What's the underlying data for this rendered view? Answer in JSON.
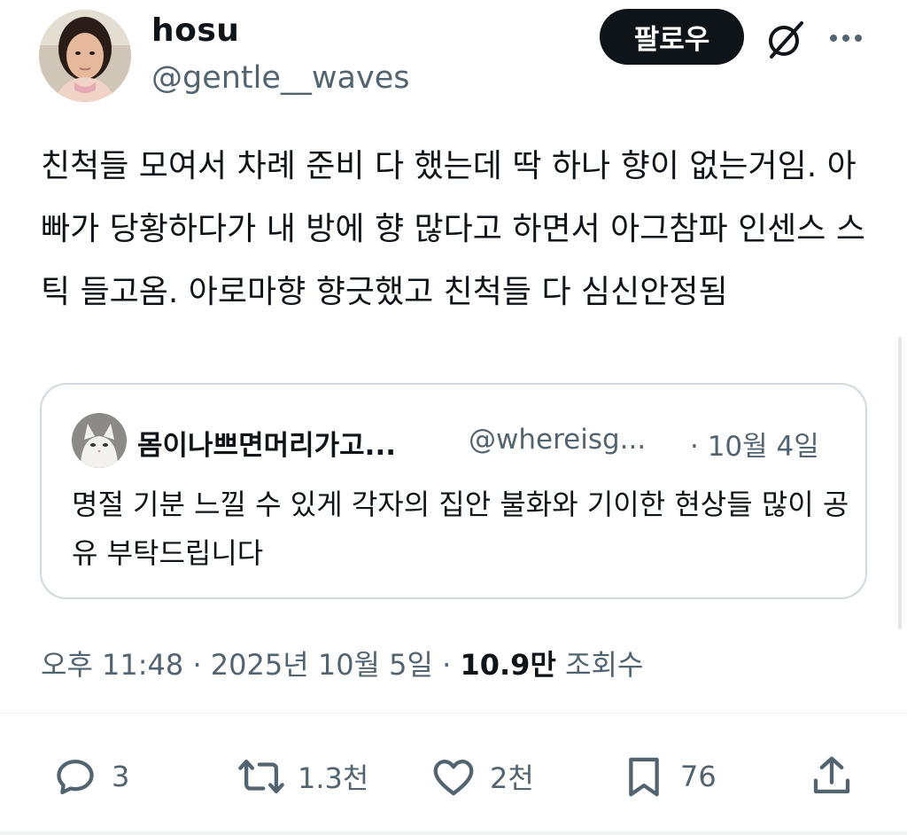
{
  "author": {
    "display_name": "hosu",
    "handle": "@gentle__waves",
    "avatar_icon": "profile-photo"
  },
  "header": {
    "follow_label": "팔로우",
    "grok_icon": "grok-icon",
    "more_icon": "more-horizontal-icon"
  },
  "tweet": {
    "text": "친척들 모여서 차례 준비 다 했는데 딱 하나 향이 없는거임. 아빠가 당황하다가 내 방에 향 많다고 하면서 아그참파 인센스 스틱 들고옴. 아로마향 향긋했고 친척들 다 심신안정됨"
  },
  "quote": {
    "display_name": "몸이나쁘면머리가고...",
    "handle": "@whereisg...",
    "date": "· 10월 4일",
    "text": "명절 기분 느낄 수 있게 각자의 집안 불화와 기이한 현상들 많이 공유 부탁드립니다",
    "avatar_icon": "cat-photo"
  },
  "meta": {
    "time": "오후 11:48 · 2025년 10월 5일 ·",
    "views_count": "10.9만",
    "views_label": "조회수"
  },
  "actions": {
    "reply_count": "3",
    "retweet_count": "1.3천",
    "like_count": "2천",
    "bookmark_count": "76"
  },
  "colors": {
    "text": "#0f1419",
    "secondary": "#536471",
    "border": "#cfd9de",
    "button_bg": "#0f1419"
  }
}
